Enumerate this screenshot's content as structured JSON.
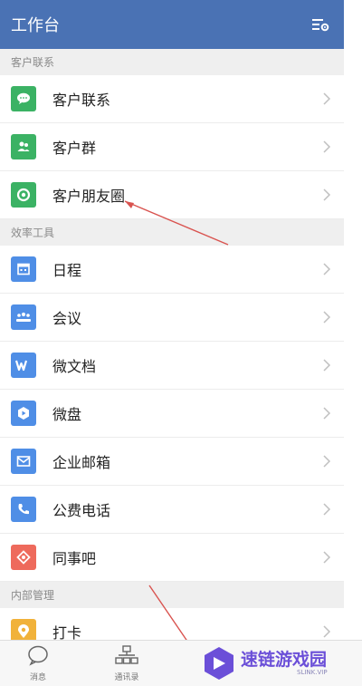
{
  "header": {
    "title": "工作台",
    "settings_icon": "settings-list-icon",
    "bg": "#4a72b4"
  },
  "sections": [
    {
      "title": "客户联系",
      "items": [
        {
          "label": "客户联系",
          "icon": "chat-bubble-icon",
          "color": "#3bb264"
        },
        {
          "label": "客户群",
          "icon": "group-icon",
          "color": "#3bb264"
        },
        {
          "label": "客户朋友圈",
          "icon": "moments-icon",
          "color": "#3bb264"
        }
      ]
    },
    {
      "title": "效率工具",
      "items": [
        {
          "label": "日程",
          "icon": "calendar-icon",
          "color": "#4f8ee6"
        },
        {
          "label": "会议",
          "icon": "meeting-icon",
          "color": "#4f8ee6"
        },
        {
          "label": "微文档",
          "icon": "document-icon",
          "color": "#4f8ee6"
        },
        {
          "label": "微盘",
          "icon": "disk-icon",
          "color": "#4f8ee6"
        },
        {
          "label": "企业邮箱",
          "icon": "mail-icon",
          "color": "#4f8ee6"
        },
        {
          "label": "公费电话",
          "icon": "phone-icon",
          "color": "#4f8ee6"
        },
        {
          "label": "同事吧",
          "icon": "community-icon",
          "color": "#ee6a5c"
        }
      ]
    },
    {
      "title": "内部管理",
      "items": [
        {
          "label": "打卡",
          "icon": "location-pin-icon",
          "color": "#f1b23a"
        }
      ]
    }
  ],
  "bottom_nav": [
    {
      "label": "消息",
      "icon": "message-icon"
    },
    {
      "label": "通讯录",
      "icon": "contacts-icon"
    }
  ],
  "watermark": {
    "text": "速链游戏园",
    "sub": "SLINK.VIP",
    "color": "#6b4fd8"
  }
}
